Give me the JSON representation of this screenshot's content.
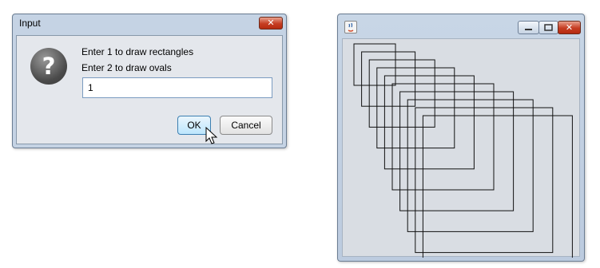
{
  "dialog": {
    "title": "Input",
    "close_glyph": "✕",
    "icon": "question-icon",
    "message_line1": "Enter 1 to draw rectangles",
    "message_line2": "Enter 2 to draw ovals",
    "input_value": "1",
    "ok_label": "OK",
    "cancel_label": "Cancel"
  },
  "window": {
    "icon": "java-icon",
    "close_glyph": "✕",
    "shape_count": 10,
    "shape": "rectangle"
  }
}
